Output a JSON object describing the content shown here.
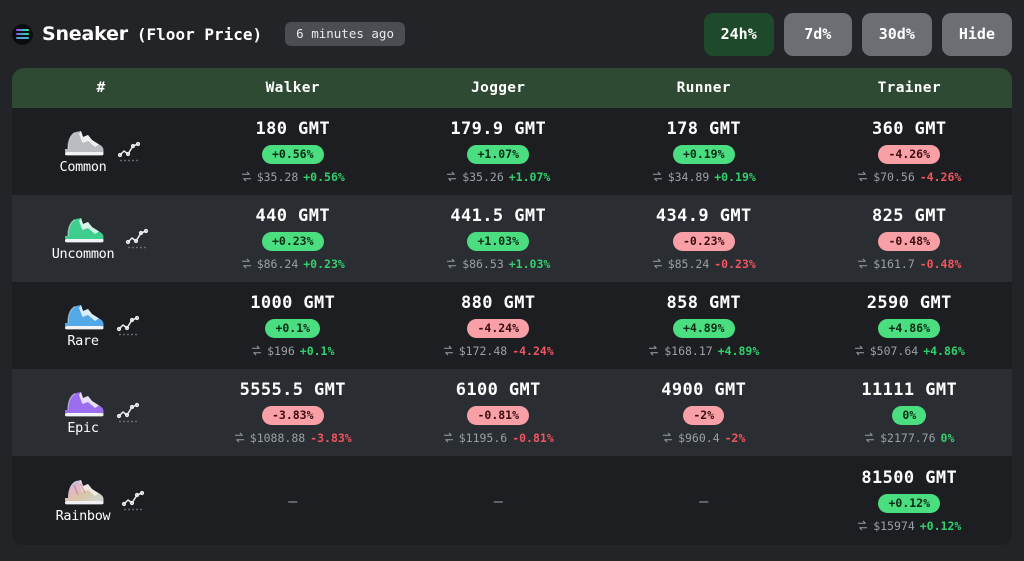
{
  "header": {
    "logo_icon": "solana-logo-icon",
    "title": "Sneaker",
    "subtitle": "(Floor Price)",
    "updated": "6 minutes ago",
    "buttons": [
      {
        "label": "24h%",
        "active": true
      },
      {
        "label": "7d%",
        "active": false
      },
      {
        "label": "30d%",
        "active": false
      },
      {
        "label": "Hide",
        "active": false
      }
    ]
  },
  "colors": {
    "accent_green": "#2e4a33",
    "active_button": "#1e4a2b",
    "badge_up": "#4ade80",
    "badge_down": "#f8a0a6",
    "text_up": "#34d06c",
    "text_down": "#f2555f",
    "page_bg": "#232428",
    "row_odd": "#1c1e22",
    "row_even": "#2a2d32"
  },
  "table": {
    "columns": [
      "#",
      "Walker",
      "Jogger",
      "Runner",
      "Trainer"
    ],
    "rows": [
      {
        "rarity": "Common",
        "shoe_color": "#b9bcc0",
        "cells": [
          {
            "price": "180 GMT",
            "change": "+0.56%",
            "dir": "up",
            "usd": "$35.28",
            "usd_change": "+0.56%"
          },
          {
            "price": "179.9 GMT",
            "change": "+1.07%",
            "dir": "up",
            "usd": "$35.26",
            "usd_change": "+1.07%"
          },
          {
            "price": "178 GMT",
            "change": "+0.19%",
            "dir": "up",
            "usd": "$34.89",
            "usd_change": "+0.19%"
          },
          {
            "price": "360 GMT",
            "change": "-4.26%",
            "dir": "down",
            "usd": "$70.56",
            "usd_change": "-4.26%"
          }
        ]
      },
      {
        "rarity": "Uncommon",
        "shoe_color": "#3ecf8e",
        "cells": [
          {
            "price": "440 GMT",
            "change": "+0.23%",
            "dir": "up",
            "usd": "$86.24",
            "usd_change": "+0.23%"
          },
          {
            "price": "441.5 GMT",
            "change": "+1.03%",
            "dir": "up",
            "usd": "$86.53",
            "usd_change": "+1.03%"
          },
          {
            "price": "434.9 GMT",
            "change": "-0.23%",
            "dir": "down",
            "usd": "$85.24",
            "usd_change": "-0.23%"
          },
          {
            "price": "825 GMT",
            "change": "-0.48%",
            "dir": "down",
            "usd": "$161.7",
            "usd_change": "-0.48%"
          }
        ]
      },
      {
        "rarity": "Rare",
        "shoe_color": "#53a8e8",
        "cells": [
          {
            "price": "1000 GMT",
            "change": "+0.1%",
            "dir": "up",
            "usd": "$196",
            "usd_change": "+0.1%"
          },
          {
            "price": "880 GMT",
            "change": "-4.24%",
            "dir": "down",
            "usd": "$172.48",
            "usd_change": "-4.24%"
          },
          {
            "price": "858 GMT",
            "change": "+4.89%",
            "dir": "up",
            "usd": "$168.17",
            "usd_change": "+4.89%"
          },
          {
            "price": "2590 GMT",
            "change": "+4.86%",
            "dir": "up",
            "usd": "$507.64",
            "usd_change": "+4.86%"
          }
        ]
      },
      {
        "rarity": "Epic",
        "shoe_color": "#9b6ef0",
        "cells": [
          {
            "price": "5555.5 GMT",
            "change": "-3.83%",
            "dir": "down",
            "usd": "$1088.88",
            "usd_change": "-3.83%"
          },
          {
            "price": "6100 GMT",
            "change": "-0.81%",
            "dir": "down",
            "usd": "$1195.6",
            "usd_change": "-0.81%"
          },
          {
            "price": "4900 GMT",
            "change": "-2%",
            "dir": "down",
            "usd": "$960.4",
            "usd_change": "-2%"
          },
          {
            "price": "11111 GMT",
            "change": "0%",
            "dir": "up",
            "usd": "$2177.76",
            "usd_change": "0%"
          }
        ]
      },
      {
        "rarity": "Rainbow",
        "shoe_color": "#d9b8c8",
        "cells": [
          {
            "empty": true,
            "dash": "–"
          },
          {
            "empty": true,
            "dash": "–"
          },
          {
            "empty": true,
            "dash": "–"
          },
          {
            "price": "81500 GMT",
            "change": "+0.12%",
            "dir": "up",
            "usd": "$15974",
            "usd_change": "+0.12%"
          }
        ]
      }
    ]
  }
}
